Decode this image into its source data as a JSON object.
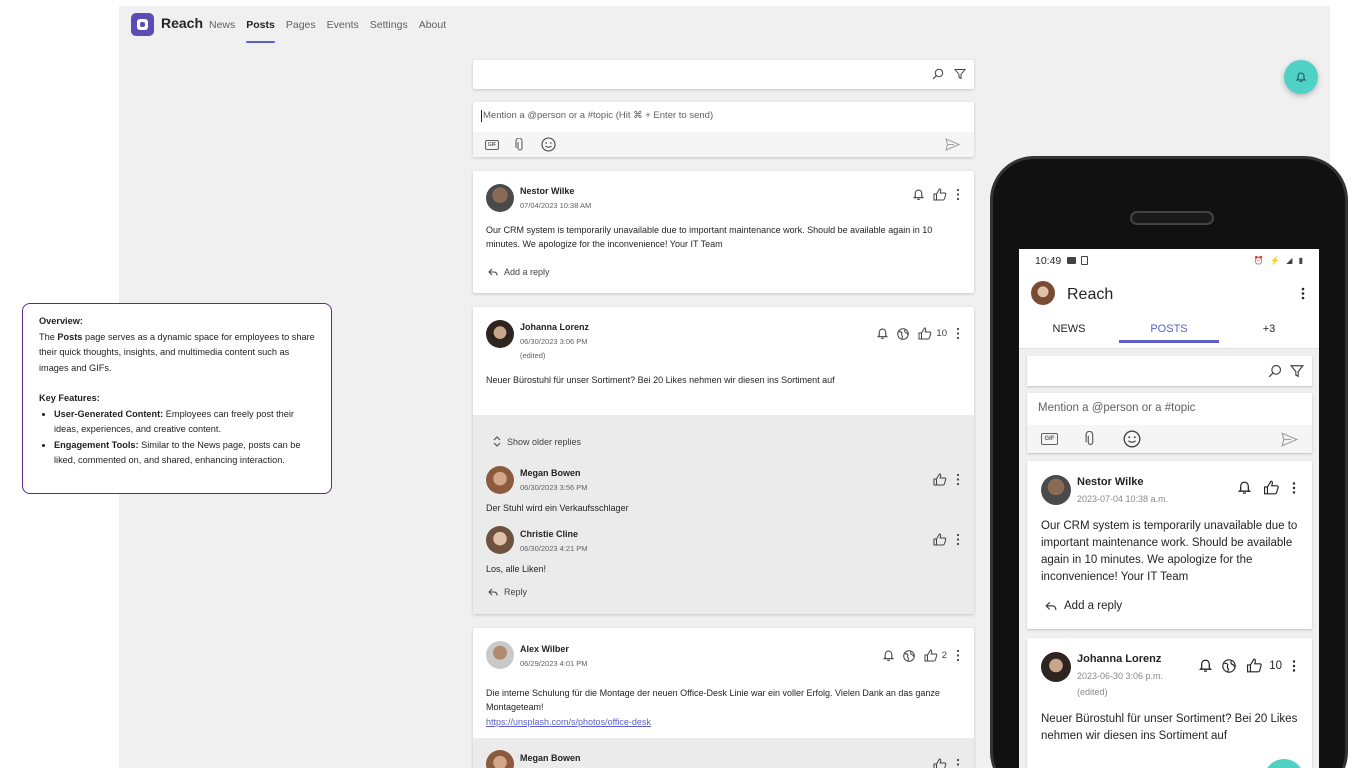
{
  "app": {
    "title": "Reach",
    "nav": [
      {
        "label": "News",
        "active": false
      },
      {
        "label": "Posts",
        "active": true
      },
      {
        "label": "Pages",
        "active": false
      },
      {
        "label": "Events",
        "active": false
      },
      {
        "label": "Settings",
        "active": false
      },
      {
        "label": "About",
        "active": false
      }
    ]
  },
  "composer": {
    "placeholder": "Mention a @person or a #topic (Hit ⌘ + Enter to send)",
    "gif_label": "GIF"
  },
  "posts": [
    {
      "author": "Nestor Wilke",
      "timestamp": "07/04/2023 10:38 AM",
      "body": "Our CRM system is temporarily unavailable due to important maintenance work. Should be available again in 10 minutes. We apologize for the inconvenience! Your IT Team",
      "reply_label": "Add a reply"
    },
    {
      "author": "Johanna Lorenz",
      "timestamp": "06/30/2023 3:06 PM",
      "edited": "(edited)",
      "body": "Neuer Bürostuhl für unser Sortiment? Bei 20 Likes nehmen wir diesen ins Sortiment auf",
      "likes": "10",
      "show_older": "Show older replies",
      "replies": [
        {
          "author": "Megan Bowen",
          "timestamp": "06/30/2023 3:56 PM",
          "body": "Der Stuhl wird ein Verkaufsschlager"
        },
        {
          "author": "Christie Cline",
          "timestamp": "06/30/2023 4:21 PM",
          "body": "Los, alle Liken!"
        }
      ],
      "reply_label": "Reply"
    },
    {
      "author": "Alex Wilber",
      "timestamp": "06/29/2023 4:01 PM",
      "body": "Die interne Schulung für die Montage der neuen Office-Desk Linie war ein voller Erfolg. Vielen Dank an das ganze Montageteam!",
      "link": "https://unsplash.com/s/photos/office-desk",
      "likes": "2",
      "next_reply_author": "Megan Bowen"
    }
  ],
  "overview": {
    "title": "Overview:",
    "intro_pre": "The ",
    "intro_bold": "Posts",
    "intro_post": " page serves as a dynamic space for employees to share their quick thoughts, insights, and multimedia content such as images and GIFs.",
    "features_title": "Key Features:",
    "features": [
      {
        "name": "User-Generated Content:",
        "text": " Employees can freely post their ideas, experiences, and creative content."
      },
      {
        "name": "Engagement Tools:",
        "text": " Similar to the News page, posts can be liked, commented on, and shared, enhancing interaction."
      }
    ]
  },
  "phone": {
    "time": "10:49",
    "title": "Reach",
    "tabs": [
      "NEWS",
      "POSTS",
      "+3"
    ],
    "composer_placeholder": "Mention a @person or a #topic",
    "gif_label": "GIF",
    "posts": [
      {
        "author": "Nestor Wilke",
        "timestamp": "2023-07-04 10:38 a.m.",
        "body": "Our CRM system is temporarily unavailable due to important maintenance work. Should be available again in 10 minutes. We apologize for the inconvenience! Your IT Team",
        "reply_label": "Add a reply"
      },
      {
        "author": "Johanna Lorenz",
        "timestamp": "2023-06-30 3:06 p.m.",
        "edited": "(edited)",
        "likes": "10",
        "body": "Neuer Bürostuhl für unser Sortiment? Bei 20 Likes nehmen wir diesen ins Sortiment auf"
      }
    ]
  },
  "colors": {
    "brand": "#5b4db3",
    "accent": "#5b5fc7",
    "fab": "#4fd1c5",
    "overview_border": "#5b2c8e"
  }
}
